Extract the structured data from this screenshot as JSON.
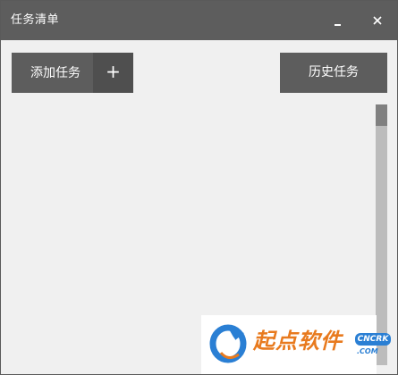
{
  "window": {
    "title": "任务清单"
  },
  "toolbar": {
    "add_task_label": "添加任务",
    "add_task_plus": "+",
    "history_label": "历史任务"
  },
  "icons": {
    "minimize": "minimize-icon",
    "close": "close-icon",
    "add": "plus-icon"
  },
  "watermark": {
    "text": "起点软件",
    "badge": "CNCRK",
    "sub": ".COM"
  },
  "colors": {
    "titlebar": "#5d5d5d",
    "button": "#5d5d5d",
    "plus_button": "#4f4f4f",
    "background": "#f0f0f0",
    "scrollbar_track": "#bcbcbc",
    "scrollbar_thumb": "#808080",
    "watermark_orange": "#e87a1e",
    "watermark_blue": "#2a7fd4"
  }
}
